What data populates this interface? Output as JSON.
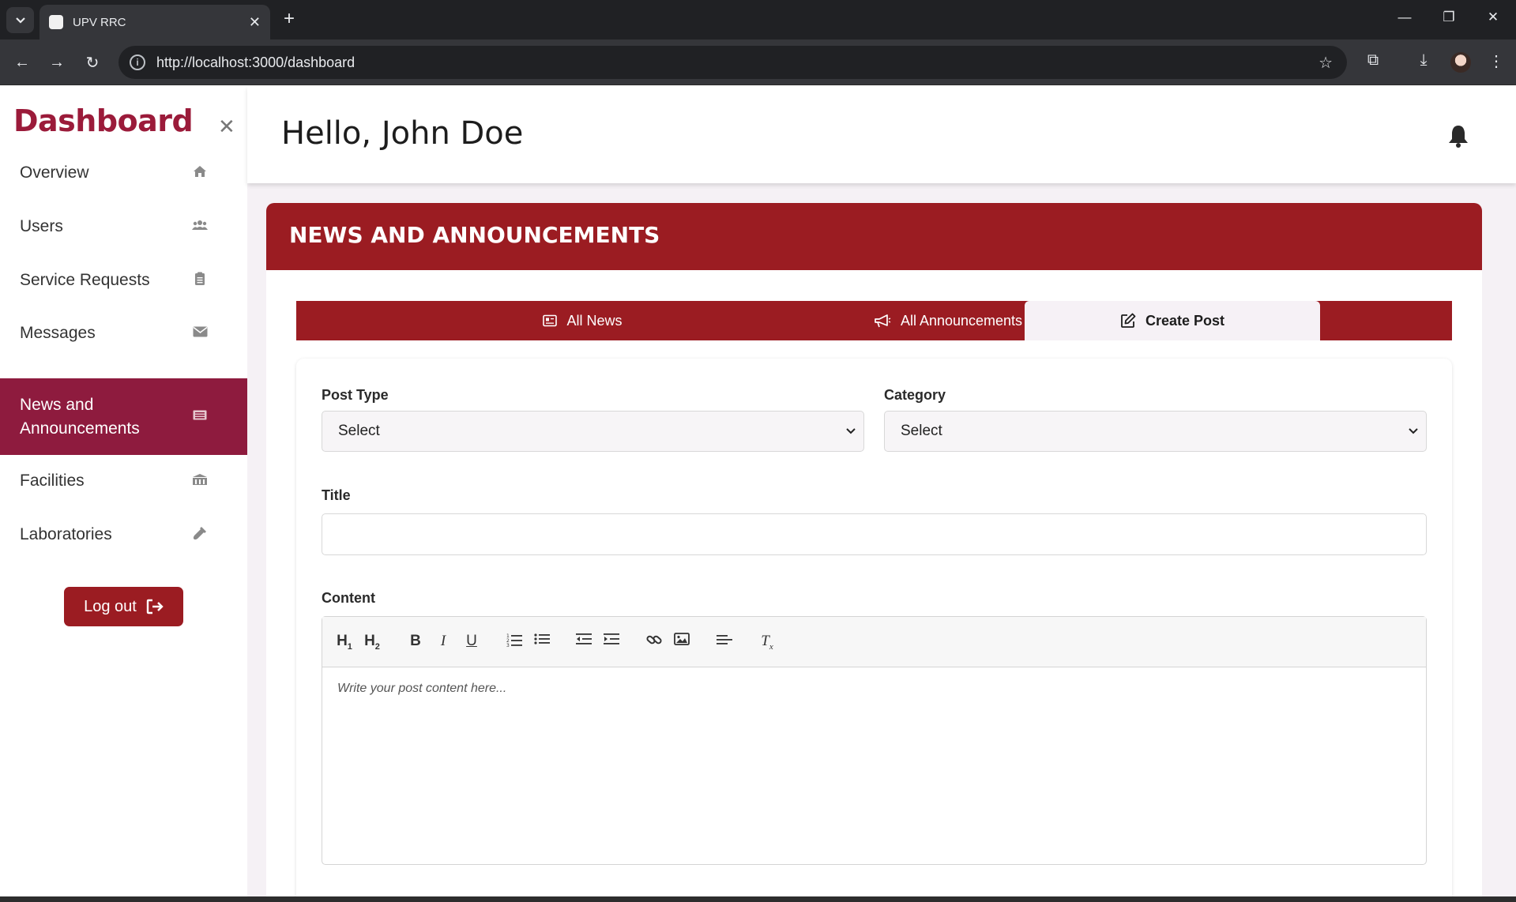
{
  "browser": {
    "tab_title": "UPV RRC",
    "url": "http://localhost:3000/dashboard"
  },
  "sidebar": {
    "brand": "Dashboard",
    "items": [
      {
        "label": "Overview",
        "icon": "home-icon"
      },
      {
        "label": "Users",
        "icon": "users-icon"
      },
      {
        "label": "Service Requests",
        "icon": "clipboard-icon"
      },
      {
        "label": "Messages",
        "icon": "envelope-icon"
      },
      {
        "label": "News and Announcements",
        "icon": "newspaper-icon",
        "active": true
      },
      {
        "label": "Facilities",
        "icon": "building-icon"
      },
      {
        "label": "Laboratories",
        "icon": "flask-icon"
      }
    ],
    "logout_label": "Log out"
  },
  "header": {
    "greeting": "Hello, John Doe"
  },
  "panel": {
    "title": "NEWS AND ANNOUNCEMENTS",
    "tabs": [
      {
        "label": "All News"
      },
      {
        "label": "All Announcements"
      },
      {
        "label": "Create Post",
        "active": true
      }
    ]
  },
  "form": {
    "post_type_label": "Post Type",
    "post_type_value": "Select",
    "category_label": "Category",
    "category_value": "Select",
    "title_label": "Title",
    "title_value": "",
    "content_label": "Content",
    "content_placeholder": "Write your post content here...",
    "toolbar": [
      "H1",
      "H2",
      "bold",
      "italic",
      "underline",
      "ordered-list",
      "bullet-list",
      "outdent",
      "indent",
      "link",
      "image",
      "align",
      "clear-format"
    ]
  },
  "colors": {
    "brand": "#9b1b3a",
    "primary": "#9b1c22",
    "sidebar_active": "#8e1b3e",
    "background": "#f5f1f5"
  }
}
